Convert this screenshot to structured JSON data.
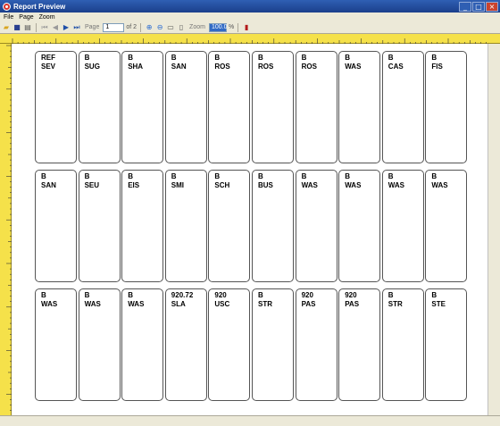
{
  "window": {
    "title": "Report Preview"
  },
  "menu": [
    "File",
    "Page",
    "Zoom"
  ],
  "toolbar": {
    "page_label": "Page",
    "page_value": "1",
    "page_of": "of 2",
    "zoom_label": "Zoom",
    "zoom_value": "100.0",
    "zoom_unit": "%"
  },
  "labels": [
    [
      "REF",
      "SEV"
    ],
    [
      "B",
      "SUG"
    ],
    [
      "B",
      "SHA"
    ],
    [
      "B",
      "SAN"
    ],
    [
      "B",
      "ROS"
    ],
    [
      "B",
      "ROS"
    ],
    [
      "B",
      "ROS"
    ],
    [
      "B",
      "WAS"
    ],
    [
      "B",
      "CAS"
    ],
    [
      "B",
      "FIS"
    ],
    [
      "B",
      "SAN"
    ],
    [
      "B",
      "SEU"
    ],
    [
      "B",
      "EIS"
    ],
    [
      "B",
      "SMI"
    ],
    [
      "B",
      "SCH"
    ],
    [
      "B",
      "BUS"
    ],
    [
      "B",
      "WAS"
    ],
    [
      "B",
      "WAS"
    ],
    [
      "B",
      "WAS"
    ],
    [
      "B",
      "WAS"
    ],
    [
      "B",
      "WAS"
    ],
    [
      "B",
      "WAS"
    ],
    [
      "B",
      "WAS"
    ],
    [
      "920.72",
      "SLA"
    ],
    [
      "920",
      "USC"
    ],
    [
      "B",
      "STR"
    ],
    [
      "920",
      "PAS"
    ],
    [
      "920",
      "PAS"
    ],
    [
      "B",
      "STR"
    ],
    [
      "B",
      "STE"
    ]
  ]
}
